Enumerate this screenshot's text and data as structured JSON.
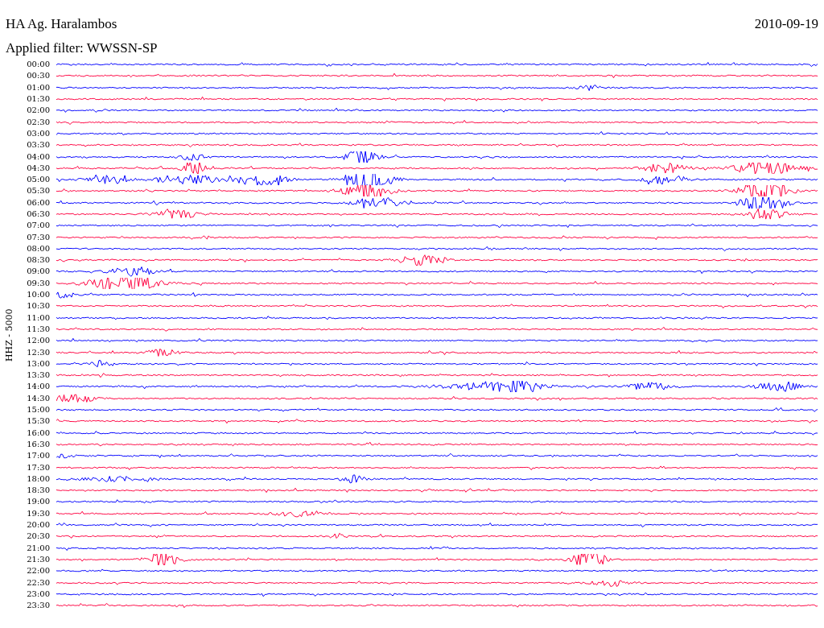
{
  "header": {
    "station": "HA Ag. Haralambos",
    "date": "2010-09-19",
    "filter": "Applied filter: WWSSN-SP"
  },
  "channel_label": "HHZ - 5000",
  "rows": [
    {
      "time": "00:00",
      "color": "#0000ff"
    },
    {
      "time": "00:30",
      "color": "#ff0040"
    },
    {
      "time": "01:00",
      "color": "#0000ff"
    },
    {
      "time": "01:30",
      "color": "#ff0040"
    },
    {
      "time": "02:00",
      "color": "#0000ff"
    },
    {
      "time": "02:30",
      "color": "#ff0040"
    },
    {
      "time": "03:00",
      "color": "#0000ff"
    },
    {
      "time": "03:30",
      "color": "#ff0040"
    },
    {
      "time": "04:00",
      "color": "#0000ff"
    },
    {
      "time": "04:30",
      "color": "#ff0040"
    },
    {
      "time": "05:00",
      "color": "#0000ff"
    },
    {
      "time": "05:30",
      "color": "#ff0040"
    },
    {
      "time": "06:00",
      "color": "#0000ff"
    },
    {
      "time": "06:30",
      "color": "#ff0040"
    },
    {
      "time": "07:00",
      "color": "#0000ff"
    },
    {
      "time": "07:30",
      "color": "#ff0040"
    },
    {
      "time": "08:00",
      "color": "#0000ff"
    },
    {
      "time": "08:30",
      "color": "#ff0040"
    },
    {
      "time": "09:00",
      "color": "#0000ff"
    },
    {
      "time": "09:30",
      "color": "#ff0040"
    },
    {
      "time": "10:00",
      "color": "#0000ff"
    },
    {
      "time": "10:30",
      "color": "#ff0040"
    },
    {
      "time": "11:00",
      "color": "#0000ff"
    },
    {
      "time": "11:30",
      "color": "#ff0040"
    },
    {
      "time": "12:00",
      "color": "#0000ff"
    },
    {
      "time": "12:30",
      "color": "#ff0040"
    },
    {
      "time": "13:00",
      "color": "#0000ff"
    },
    {
      "time": "13:30",
      "color": "#ff0040"
    },
    {
      "time": "14:00",
      "color": "#0000ff"
    },
    {
      "time": "14:30",
      "color": "#ff0040"
    },
    {
      "time": "15:00",
      "color": "#0000ff"
    },
    {
      "time": "15:30",
      "color": "#ff0040"
    },
    {
      "time": "16:00",
      "color": "#0000ff"
    },
    {
      "time": "16:30",
      "color": "#ff0040"
    },
    {
      "time": "17:00",
      "color": "#0000ff"
    },
    {
      "time": "17:30",
      "color": "#ff0040"
    },
    {
      "time": "18:00",
      "color": "#0000ff"
    },
    {
      "time": "18:30",
      "color": "#ff0040"
    },
    {
      "time": "19:00",
      "color": "#0000ff"
    },
    {
      "time": "19:30",
      "color": "#ff0040"
    },
    {
      "time": "20:00",
      "color": "#0000ff"
    },
    {
      "time": "20:30",
      "color": "#ff0040"
    },
    {
      "time": "21:00",
      "color": "#0000ff"
    },
    {
      "time": "21:30",
      "color": "#ff0040"
    },
    {
      "time": "22:00",
      "color": "#0000ff"
    },
    {
      "time": "22:30",
      "color": "#ff0040"
    },
    {
      "time": "23:00",
      "color": "#0000ff"
    },
    {
      "time": "23:30",
      "color": "#ff0040"
    }
  ]
}
